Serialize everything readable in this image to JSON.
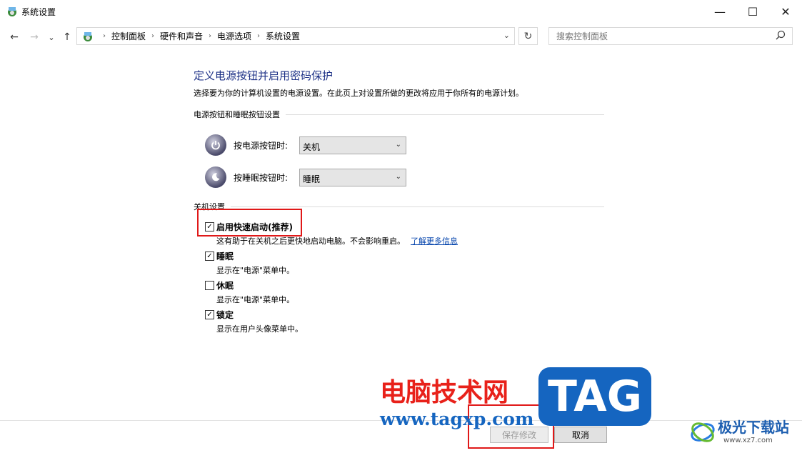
{
  "window": {
    "title": "系统设置",
    "controls": {
      "minimize": "—",
      "maximize": "☐",
      "close": "✕"
    }
  },
  "nav": {
    "back": "←",
    "forward": "→",
    "recent": "⌄",
    "up": "↑",
    "breadcrumb": [
      "控制面板",
      "硬件和声音",
      "电源选项",
      "系统设置"
    ],
    "dropdown": "⌄",
    "refresh": "↻"
  },
  "search": {
    "placeholder": "搜索控制面板"
  },
  "main": {
    "heading": "定义电源按钮并启用密码保护",
    "description": "选择要为你的计算机设置的电源设置。在此页上对设置所做的更改将应用于你所有的电源计划。",
    "power_section": {
      "title": "电源按钮和睡眠按钮设置",
      "power_button_label": "按电源按钮时:",
      "power_button_value": "关机",
      "sleep_button_label": "按睡眠按钮时:",
      "sleep_button_value": "睡眠"
    },
    "shutdown_section": {
      "title": "关机设置",
      "options": [
        {
          "label": "启用快速启动(推荐)",
          "checked": true,
          "sub": "这有助于在关机之后更快地启动电脑。不会影响重启。",
          "link": "了解更多信息"
        },
        {
          "label": "睡眠",
          "checked": true,
          "sub": "显示在\"电源\"菜单中。"
        },
        {
          "label": "休眠",
          "checked": false,
          "sub": "显示在\"电源\"菜单中。"
        },
        {
          "label": "锁定",
          "checked": true,
          "sub": "显示在用户头像菜单中。"
        }
      ]
    }
  },
  "footer": {
    "save_label": "保存修改",
    "cancel_label": "取消"
  },
  "watermark": {
    "site_name": "电脑技术网",
    "url": "www.tagxp.com",
    "logo": "TAG",
    "corner_brand": "极光下载站",
    "corner_url": "www.xz7.com"
  },
  "colors": {
    "heading": "#1e3287",
    "highlight": "#e01818",
    "link": "#0645ad",
    "watermark_red": "#e8211a",
    "watermark_blue": "#1565c0"
  }
}
